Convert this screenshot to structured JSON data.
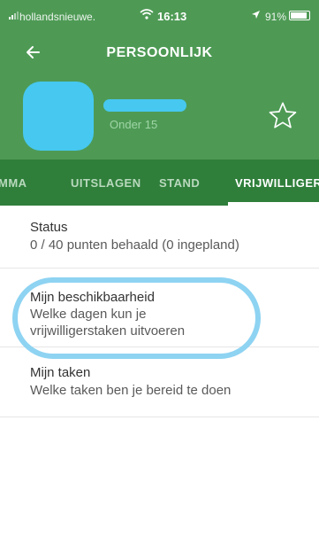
{
  "status_bar": {
    "carrier": "hollandsnieuwe.",
    "time": "16:13",
    "battery": "91%",
    "battery_level": 0.91
  },
  "header": {
    "back_icon": "arrow-left-icon",
    "title": "PERSOONLIJK"
  },
  "profile": {
    "team": "Onder 15",
    "favorite_icon": "star-outline-icon"
  },
  "tabs": [
    {
      "label": "MMA",
      "active": false
    },
    {
      "label": "UITSLAGEN",
      "active": false
    },
    {
      "label": "STAND",
      "active": false
    },
    {
      "label": "VRIJWILLIGER",
      "active": true
    }
  ],
  "items": [
    {
      "title": "Status",
      "subtitle": "0 / 40 punten behaald (0 ingepland)"
    },
    {
      "title": "Mijn beschikbaarheid",
      "subtitle_line1": "Welke dagen kun je",
      "subtitle_line2": "vrijwilligerstaken uitvoeren"
    },
    {
      "title": "Mijn taken",
      "subtitle": "Welke taken ben je bereid te doen"
    }
  ],
  "colors": {
    "header_green": "#4e9a55",
    "tab_green": "#2f7f3b",
    "annotation_blue": "#8ed3f2"
  }
}
